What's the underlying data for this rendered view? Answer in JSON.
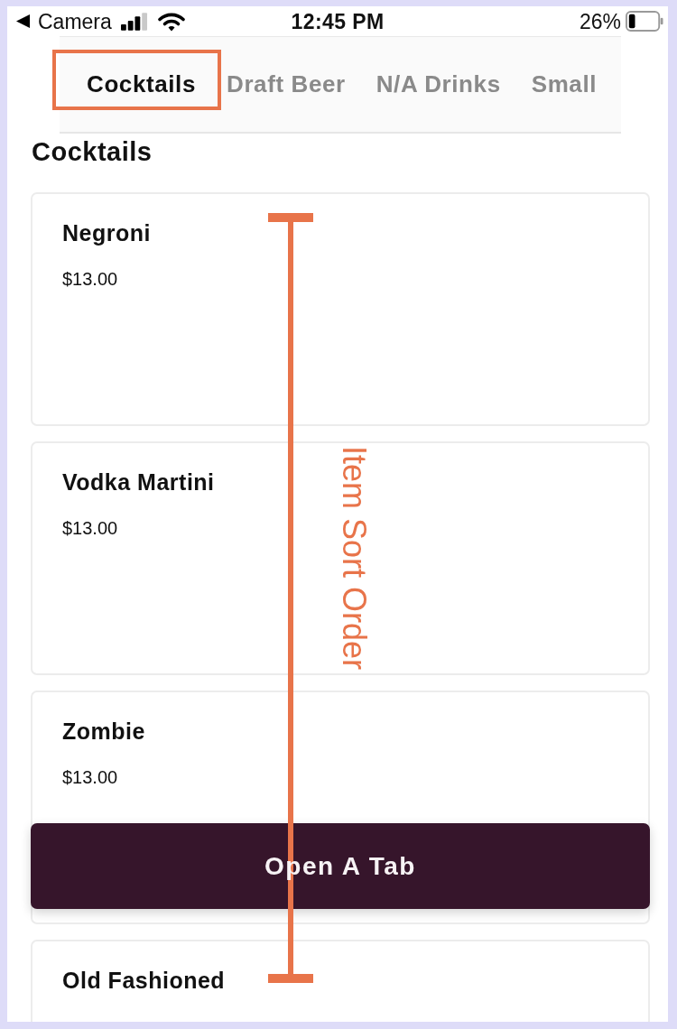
{
  "status_bar": {
    "back_label": "Camera",
    "time": "12:45 PM",
    "battery": "26%"
  },
  "tabs": [
    {
      "label": "Cocktails",
      "selected": true,
      "annotated": true
    },
    {
      "label": "Draft Beer",
      "selected": false,
      "annotated": false
    },
    {
      "label": "N/A Drinks",
      "selected": false,
      "annotated": false
    },
    {
      "label": "Small",
      "selected": false,
      "annotated": false
    }
  ],
  "section_title": "Cocktails",
  "items": [
    {
      "name": "Negroni",
      "price": "$13.00"
    },
    {
      "name": "Vodka Martini",
      "price": "$13.00"
    },
    {
      "name": "Zombie",
      "price": "$13.00"
    },
    {
      "name": "Old Fashioned"
    }
  ],
  "action_button": {
    "label": "Open A Tab"
  },
  "annotation": {
    "label": "Item Sort Order"
  }
}
